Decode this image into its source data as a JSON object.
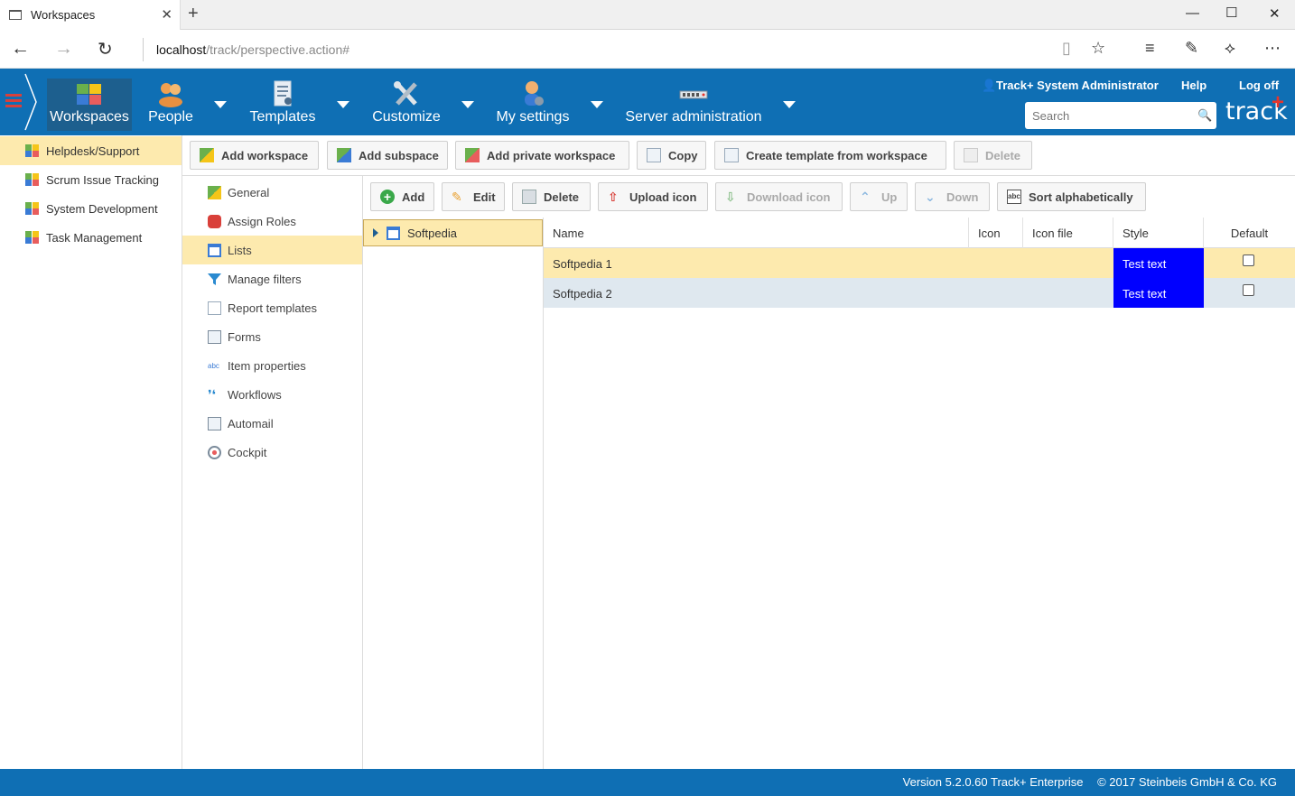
{
  "browser": {
    "tab_title": "Workspaces",
    "url_host": "localhost",
    "url_path": "/track/perspective.action#"
  },
  "header": {
    "nav": [
      {
        "label": "Workspaces",
        "icon": "puzzle-icon"
      },
      {
        "label": "People",
        "icon": "people-icon"
      },
      {
        "label": "Templates",
        "icon": "templates-icon"
      },
      {
        "label": "Customize",
        "icon": "tools-icon"
      },
      {
        "label": "My settings",
        "icon": "user-settings-icon"
      },
      {
        "label": "Server administration",
        "icon": "server-icon"
      }
    ],
    "user": "Track+ System Administrator",
    "help": "Help",
    "logoff": "Log off",
    "search_placeholder": "Search",
    "logo": "track",
    "logo_plus": "+"
  },
  "workspaces": [
    "Helpdesk/Support",
    "Scrum Issue Tracking",
    "System Development",
    "Task Management"
  ],
  "toolbar": {
    "add_workspace": "Add workspace",
    "add_subspace": "Add subspace",
    "add_private": "Add private workspace",
    "copy": "Copy",
    "create_template": "Create template from workspace",
    "delete": "Delete"
  },
  "config_nav": [
    "General",
    "Assign Roles",
    "Lists",
    "Manage filters",
    "Report templates",
    "Forms",
    "Item properties",
    "Workflows",
    "Automail",
    "Cockpit"
  ],
  "list_toolbar": {
    "add": "Add",
    "edit": "Edit",
    "delete": "Delete",
    "upload_icon": "Upload icon",
    "download_icon": "Download icon",
    "up": "Up",
    "down": "Down",
    "sort": "Sort alphabetically"
  },
  "tree": {
    "node": "Softpedia"
  },
  "grid": {
    "columns": [
      "Name",
      "Icon",
      "Icon file",
      "Style",
      "Default"
    ],
    "rows": [
      {
        "name": "Softpedia 1",
        "icon": "",
        "icon_file": "",
        "style": "Test text",
        "default": false
      },
      {
        "name": "Softpedia 2",
        "icon": "",
        "icon_file": "",
        "style": "Test text",
        "default": false
      }
    ]
  },
  "footer": {
    "version": "Version 5.2.0.60 Track+ Enterprise",
    "copyright": "© 2017 Steinbeis GmbH & Co. KG"
  },
  "colors": {
    "brand_blue": "#0f6fb4",
    "selection": "#fdeaae",
    "style_blue": "#0000ff"
  }
}
